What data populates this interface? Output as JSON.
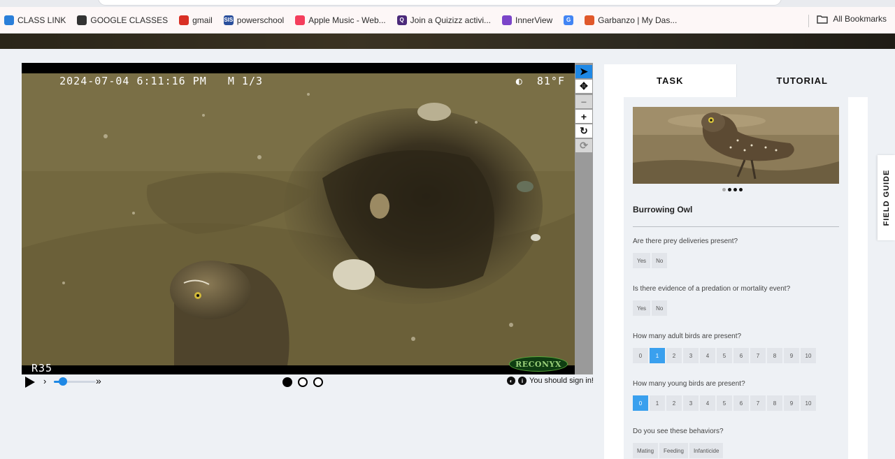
{
  "bookmarks": {
    "items": [
      {
        "label": "CLASS LINK",
        "icon": "cloud-icon",
        "color": "#2b7fd9"
      },
      {
        "label": "GOOGLE CLASSES",
        "icon": "classroom-icon",
        "color": "#333333"
      },
      {
        "label": "gmail",
        "icon": "gmail-icon",
        "color": "#d93025"
      },
      {
        "label": "powerschool",
        "icon": "powerschool-icon",
        "color": "#2a4f9c",
        "badge": "SIS"
      },
      {
        "label": "Apple Music - Web...",
        "icon": "music-icon",
        "color": "#f43e5c"
      },
      {
        "label": "Join a Quizizz activi...",
        "icon": "quizizz-icon",
        "color": "#4b2a7a",
        "badge": "Q"
      },
      {
        "label": "InnerView",
        "icon": "innerview-icon",
        "color": "#7b45c9"
      },
      {
        "label": "",
        "icon": "google-icon",
        "color": "#4285f4",
        "badge": "G"
      },
      {
        "label": "Garbanzo | My Das...",
        "icon": "garbanzo-icon",
        "color": "#e0582a"
      }
    ],
    "all_label": "All Bookmarks"
  },
  "viewer": {
    "timestamp": "2024-07-04 6:11:16 PM",
    "frame_info": "M 1/3",
    "temperature": "81°F",
    "camera_id": "R35",
    "brand": "RECONYX",
    "tools": [
      {
        "name": "pointer-tool",
        "glyph": "➤",
        "state": "active"
      },
      {
        "name": "pan-tool",
        "glyph": "✥",
        "state": "normal"
      },
      {
        "name": "zoom-out-tool",
        "glyph": "−",
        "state": "disabled"
      },
      {
        "name": "zoom-in-tool",
        "glyph": "+",
        "state": "normal"
      },
      {
        "name": "rotate-tool",
        "glyph": "↻",
        "state": "normal"
      },
      {
        "name": "reset-tool",
        "glyph": "⟳",
        "state": "disabled"
      }
    ],
    "speed_level": 0.2,
    "frames_total": 3,
    "frame_current": 1,
    "sign_in_text": "You should sign in!"
  },
  "task": {
    "tabs": [
      {
        "label": "TASK",
        "active": true
      },
      {
        "label": "TUTORIAL",
        "active": false
      }
    ],
    "species": "Burrowing Owl",
    "example_count": 4,
    "example_current": 1,
    "questions": [
      {
        "text": "Are there prey deliveries present?",
        "options": [
          "Yes",
          "No"
        ],
        "selected": null
      },
      {
        "text": "Is there evidence of a predation or mortality event?",
        "options": [
          "Yes",
          "No"
        ],
        "selected": null
      },
      {
        "text": "How many adult birds are present?",
        "options": [
          "0",
          "1",
          "2",
          "3",
          "4",
          "5",
          "6",
          "7",
          "8",
          "9",
          "10"
        ],
        "selected": "1"
      },
      {
        "text": "How many young birds are present?",
        "options": [
          "0",
          "1",
          "2",
          "3",
          "4",
          "5",
          "6",
          "7",
          "8",
          "9",
          "10"
        ],
        "selected": "0"
      },
      {
        "text": "Do you see these behaviors?",
        "options": [
          "Mating",
          "Feeding",
          "Infanticide"
        ],
        "selected": null
      }
    ]
  },
  "field_guide": {
    "label": "FIELD GUIDE"
  }
}
